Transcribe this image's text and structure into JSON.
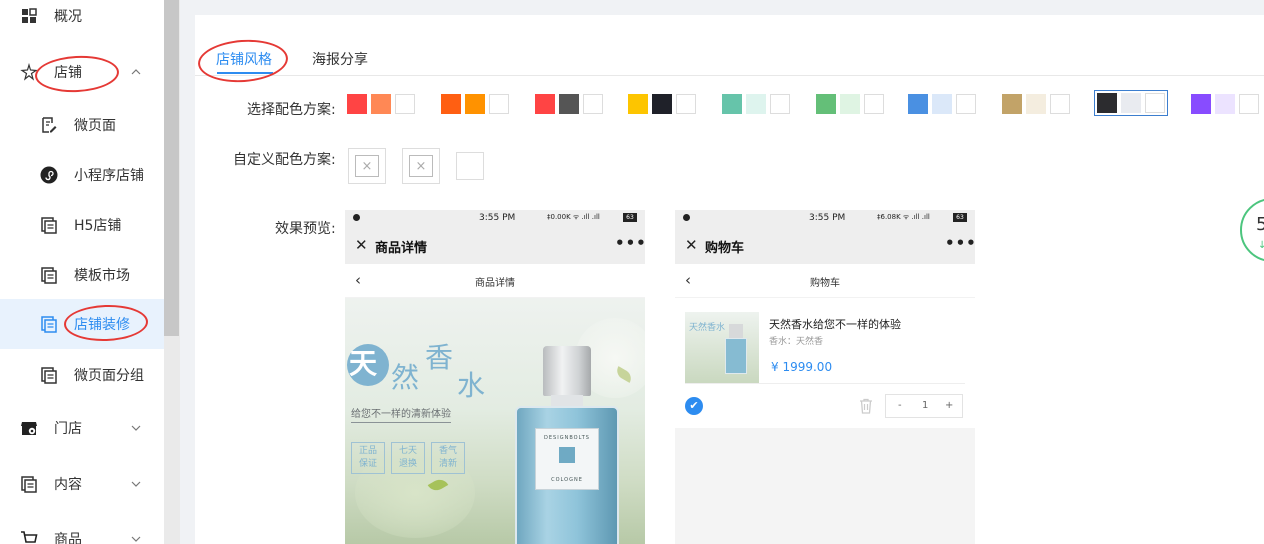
{
  "sidebar": {
    "items": [
      {
        "label": "概况",
        "icon": "dashboard-grid-icon"
      },
      {
        "label": "店铺",
        "icon": "shop-sparkle-icon"
      },
      {
        "label": "微页面",
        "icon": "edit-page-icon"
      },
      {
        "label": "小程序店铺",
        "icon": "mini-program-icon"
      },
      {
        "label": "H5店铺",
        "icon": "h5-page-icon"
      },
      {
        "label": "模板市场",
        "icon": "template-icon"
      },
      {
        "label": "店铺装修",
        "icon": "decoration-icon"
      },
      {
        "label": "微页面分组",
        "icon": "page-group-icon"
      },
      {
        "label": "门店",
        "icon": "store-settings-icon"
      },
      {
        "label": "内容",
        "icon": "content-icon"
      },
      {
        "label": "商品",
        "icon": "cart-icon"
      }
    ]
  },
  "tabs": [
    {
      "label": "店铺风格",
      "active": true
    },
    {
      "label": "海报分享",
      "active": false
    }
  ],
  "color_scheme": {
    "label": "选择配色方案:",
    "selected_index": 8,
    "schemes": [
      [
        "#ff4444",
        "#ff8855",
        "#ffffff"
      ],
      [
        "#ff5f12",
        "#ff9200",
        "#ffffff"
      ],
      [
        "#ff4444",
        "#555555",
        "#ffffff"
      ],
      [
        "#fdc500",
        "#1f2129",
        "#ffffff"
      ],
      [
        "#66c4aa",
        "#def4ee",
        "#ffffff"
      ],
      [
        "#64bf78",
        "#dff4e3",
        "#ffffff"
      ],
      [
        "#4a90e2",
        "#dbe8f9",
        "#ffffff"
      ],
      [
        "#c2a368",
        "#f4eddf",
        "#ffffff"
      ],
      [
        "#2c2c2f",
        "#e9ebf0",
        "#ffffff"
      ],
      [
        "#884cff",
        "#ece3ff",
        "#ffffff"
      ]
    ]
  },
  "custom_scheme": {
    "label": "自定义配色方案:",
    "box_glyph": "×"
  },
  "preview": {
    "label": "效果预览:",
    "detail_phone": {
      "status_time": "3:55 PM",
      "status_net": "‡0.00K ᯤ .ıll .ıll",
      "battery": "63",
      "window_title": "商品详情",
      "nav_title": "商品详情",
      "close_glyph": "✕",
      "more_glyph": "•••",
      "back_glyph": "‹",
      "product_chars": [
        "天",
        "然",
        "香",
        "水"
      ],
      "product_sub": "给您不一样的清新体验",
      "tags": [
        "正品\n保证",
        "七天\n退换",
        "香气\n清新"
      ],
      "bottle_brand": "DESIGNBOLTS",
      "bottle_type": "COLOGNE"
    },
    "cart_phone": {
      "status_time": "3:55 PM",
      "status_net": "‡6.08K ᯤ .ıll .ıll",
      "battery": "63",
      "window_title": "购物车",
      "nav_title": "购物车",
      "close_glyph": "✕",
      "more_glyph": "•••",
      "back_glyph": "‹",
      "thumb_text": "天然香水",
      "item_name": "天然香水给您不一样的体验",
      "item_spec": "香水：天然香",
      "item_price": "¥ 1999.00",
      "quantity": "1",
      "minus": "-",
      "plus": "+",
      "check_glyph": "✔"
    }
  },
  "float_badge": {
    "number": "5",
    "arrow": "↓"
  }
}
